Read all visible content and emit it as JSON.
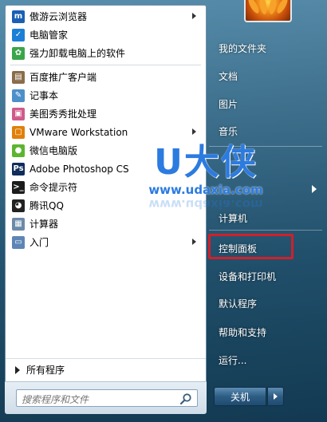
{
  "programs": [
    {
      "label": "傲游云浏览器",
      "icon": "maxthon-icon",
      "color": "#1a5fb4",
      "glyph": "m",
      "has_submenu": true
    },
    {
      "label": "电脑管家",
      "icon": "shield-icon",
      "color": "#1b7fd6",
      "glyph": "✓",
      "has_submenu": false
    },
    {
      "label": "强力卸载电脑上的软件",
      "icon": "uninstall-icon",
      "color": "#3aa54a",
      "glyph": "✿",
      "has_submenu": false
    },
    {
      "label": "百度推广客户端",
      "icon": "baidu-client-icon",
      "color": "#8a6d4a",
      "glyph": "▤",
      "has_submenu": false
    },
    {
      "label": "记事本",
      "icon": "notepad-icon",
      "color": "#4d8fc9",
      "glyph": "✎",
      "has_submenu": false
    },
    {
      "label": "美图秀秀批处理",
      "icon": "meitu-icon",
      "color": "#d05a8a",
      "glyph": "▣",
      "has_submenu": false
    },
    {
      "label": "VMware Workstation",
      "icon": "vmware-icon",
      "color": "#e0800a",
      "glyph": "▢",
      "has_submenu": true
    },
    {
      "label": "微信电脑版",
      "icon": "wechat-icon",
      "color": "#5cb531",
      "glyph": "●",
      "has_submenu": false
    },
    {
      "label": "Adobe Photoshop CS",
      "icon": "photoshop-icon",
      "color": "#0f2c5a",
      "glyph": "Ps",
      "has_submenu": false
    },
    {
      "label": "命令提示符",
      "icon": "cmd-icon",
      "color": "#1c1c1c",
      "glyph": ">_",
      "has_submenu": false
    },
    {
      "label": "腾讯QQ",
      "icon": "qq-icon",
      "color": "#222222",
      "glyph": "◕",
      "has_submenu": false
    },
    {
      "label": "计算器",
      "icon": "calculator-icon",
      "color": "#6b8aa8",
      "glyph": "▦",
      "has_submenu": false
    },
    {
      "label": "入门",
      "icon": "getting-started-icon",
      "color": "#5d86b5",
      "glyph": "▭",
      "has_submenu": true
    }
  ],
  "all_programs": "所有程序",
  "search": {
    "placeholder": "搜索程序和文件"
  },
  "right_items": [
    {
      "label": "我的文件夹",
      "name": "right-item-my-folder"
    },
    {
      "label": "文档",
      "name": "right-item-documents"
    },
    {
      "label": "图片",
      "name": "right-item-pictures"
    },
    {
      "label": "音乐",
      "name": "right-item-music"
    },
    {
      "label": "",
      "name": "right-item-games"
    },
    {
      "label": "计算机",
      "name": "right-item-computer"
    },
    {
      "label": "控制面板",
      "name": "right-item-control-panel"
    },
    {
      "label": "设备和打印机",
      "name": "right-item-devices-printers"
    },
    {
      "label": "默认程序",
      "name": "right-item-default-programs"
    },
    {
      "label": "帮助和支持",
      "name": "right-item-help-support"
    },
    {
      "label": "运行...",
      "name": "right-item-run"
    }
  ],
  "shutdown": {
    "label": "关机"
  },
  "watermark": {
    "big": "U大侠",
    "url": "www.udaxia.com"
  },
  "colors": {
    "highlight": "#d0202a",
    "watermark": "#2c7be0"
  }
}
